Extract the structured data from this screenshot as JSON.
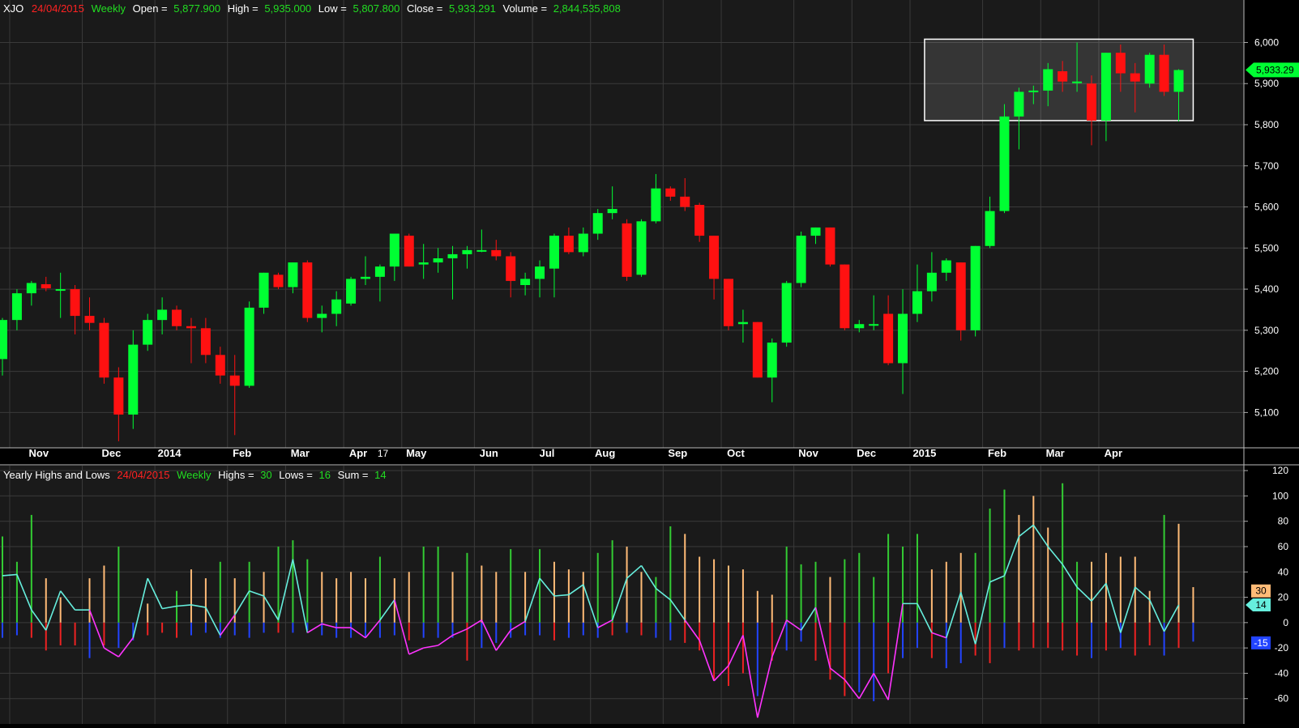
{
  "colors": {
    "background": "#000000",
    "panel": "#1a1a1a",
    "grid": "#3a3a3a",
    "axis_text": "#ffffff",
    "up": "#00ff33",
    "down": "#ff1111",
    "green_text": "#22dd22",
    "red_text": "#ff2222",
    "highs_bar": "#33cc33",
    "lows_bar": "#ee2222",
    "orange_bar": "#ffbb77",
    "blue_bar": "#2244ff",
    "sum_cyan": "#66eedd",
    "sum_magenta": "#ff33ff",
    "highlight_box": "#ffffff"
  },
  "price_header": {
    "symbol": "XJO",
    "date": "24/04/2015",
    "period": "Weekly",
    "open_label": "Open =",
    "open": "5,877.900",
    "high_label": "High =",
    "high": "5,935.000",
    "low_label": "Low =",
    "low": "5,807.800",
    "close_label": "Close =",
    "close": "5,933.291",
    "volume_label": "Volume =",
    "volume": "2,844,535,808"
  },
  "indicator_header": {
    "name": "Yearly Highs and Lows",
    "date": "24/04/2015",
    "period": "Weekly",
    "highs_label": "Highs =",
    "highs": "30",
    "lows_label": "Lows =",
    "lows": "16",
    "sum_label": "Sum =",
    "sum": "14"
  },
  "chart_data": [
    {
      "type": "candlestick",
      "title": "XJO Weekly",
      "ylim": [
        5020,
        6060
      ],
      "y_ticks": [
        "5,100",
        "5,200",
        "5,300",
        "5,400",
        "5,500",
        "5,600",
        "5,700",
        "5,800",
        "5,900",
        "6,000"
      ],
      "y_tick_values": [
        5100,
        5200,
        5300,
        5400,
        5500,
        5600,
        5700,
        5800,
        5900,
        6000
      ],
      "last_price_label": "5,933.29",
      "last_price_value": 5933.29,
      "x_month_labels": [
        "Nov",
        "Dec",
        "2014",
        "Feb",
        "Mar",
        "Apr",
        "17",
        "May",
        "Jun",
        "Jul",
        "Aug",
        "Sep",
        "Oct",
        "Nov",
        "Dec",
        "2015",
        "Feb",
        "Mar",
        "Apr"
      ],
      "x_month_label_week": [
        2.5,
        7.5,
        11.5,
        16.5,
        20.5,
        24.5,
        26.2,
        28.5,
        33.5,
        37.5,
        41.5,
        46.5,
        50.5,
        55.5,
        59.5,
        63.5,
        68.5,
        72.5,
        76.5
      ],
      "x_month_gridline_week": [
        0.5,
        5.5,
        10.5,
        15.5,
        19.5,
        23.5,
        27.5,
        32.5,
        36.5,
        40.5,
        45.5,
        49.5,
        54.5,
        58.5,
        62.5,
        67.5,
        71.5,
        75.5
      ],
      "highlight_box": {
        "from_week": 63.5,
        "to_week": 82,
        "low": 5810,
        "high": 6008
      },
      "candles": [
        {
          "o": 5230,
          "h": 5330,
          "l": 5190,
          "c": 5325
        },
        {
          "o": 5325,
          "h": 5400,
          "l": 5300,
          "c": 5390
        },
        {
          "o": 5390,
          "h": 5420,
          "l": 5360,
          "c": 5415
        },
        {
          "o": 5412,
          "h": 5430,
          "l": 5395,
          "c": 5402
        },
        {
          "o": 5400,
          "h": 5440,
          "l": 5330,
          "c": 5400
        },
        {
          "o": 5400,
          "h": 5410,
          "l": 5290,
          "c": 5335
        },
        {
          "o": 5335,
          "h": 5380,
          "l": 5300,
          "c": 5318
        },
        {
          "o": 5318,
          "h": 5330,
          "l": 5170,
          "c": 5185
        },
        {
          "o": 5185,
          "h": 5210,
          "l": 5030,
          "c": 5095
        },
        {
          "o": 5095,
          "h": 5300,
          "l": 5060,
          "c": 5265
        },
        {
          "o": 5265,
          "h": 5340,
          "l": 5250,
          "c": 5325
        },
        {
          "o": 5325,
          "h": 5380,
          "l": 5290,
          "c": 5350
        },
        {
          "o": 5350,
          "h": 5360,
          "l": 5300,
          "c": 5310
        },
        {
          "o": 5310,
          "h": 5330,
          "l": 5220,
          "c": 5305
        },
        {
          "o": 5305,
          "h": 5330,
          "l": 5220,
          "c": 5240
        },
        {
          "o": 5240,
          "h": 5260,
          "l": 5170,
          "c": 5190
        },
        {
          "o": 5190,
          "h": 5240,
          "l": 5045,
          "c": 5165
        },
        {
          "o": 5165,
          "h": 5370,
          "l": 5160,
          "c": 5355
        },
        {
          "o": 5355,
          "h": 5440,
          "l": 5340,
          "c": 5440
        },
        {
          "o": 5435,
          "h": 5440,
          "l": 5400,
          "c": 5405
        },
        {
          "o": 5405,
          "h": 5465,
          "l": 5390,
          "c": 5465
        },
        {
          "o": 5465,
          "h": 5470,
          "l": 5320,
          "c": 5330
        },
        {
          "o": 5330,
          "h": 5360,
          "l": 5295,
          "c": 5340
        },
        {
          "o": 5340,
          "h": 5395,
          "l": 5310,
          "c": 5375
        },
        {
          "o": 5365,
          "h": 5430,
          "l": 5360,
          "c": 5425
        },
        {
          "o": 5425,
          "h": 5480,
          "l": 5410,
          "c": 5430
        },
        {
          "o": 5430,
          "h": 5460,
          "l": 5370,
          "c": 5455
        },
        {
          "o": 5455,
          "h": 5535,
          "l": 5420,
          "c": 5535
        },
        {
          "o": 5530,
          "h": 5535,
          "l": 5455,
          "c": 5455
        },
        {
          "o": 5460,
          "h": 5510,
          "l": 5425,
          "c": 5465
        },
        {
          "o": 5465,
          "h": 5500,
          "l": 5440,
          "c": 5475
        },
        {
          "o": 5475,
          "h": 5505,
          "l": 5375,
          "c": 5485
        },
        {
          "o": 5485,
          "h": 5505,
          "l": 5450,
          "c": 5495
        },
        {
          "o": 5495,
          "h": 5545,
          "l": 5490,
          "c": 5495
        },
        {
          "o": 5495,
          "h": 5520,
          "l": 5470,
          "c": 5480
        },
        {
          "o": 5480,
          "h": 5490,
          "l": 5380,
          "c": 5420
        },
        {
          "o": 5410,
          "h": 5440,
          "l": 5385,
          "c": 5425
        },
        {
          "o": 5425,
          "h": 5470,
          "l": 5380,
          "c": 5455
        },
        {
          "o": 5450,
          "h": 5535,
          "l": 5380,
          "c": 5530
        },
        {
          "o": 5530,
          "h": 5550,
          "l": 5485,
          "c": 5490
        },
        {
          "o": 5490,
          "h": 5550,
          "l": 5480,
          "c": 5535
        },
        {
          "o": 5535,
          "h": 5595,
          "l": 5520,
          "c": 5585
        },
        {
          "o": 5585,
          "h": 5650,
          "l": 5570,
          "c": 5595
        },
        {
          "o": 5560,
          "h": 5570,
          "l": 5420,
          "c": 5430
        },
        {
          "o": 5435,
          "h": 5570,
          "l": 5430,
          "c": 5565
        },
        {
          "o": 5565,
          "h": 5680,
          "l": 5560,
          "c": 5645
        },
        {
          "o": 5645,
          "h": 5650,
          "l": 5615,
          "c": 5625
        },
        {
          "o": 5625,
          "h": 5670,
          "l": 5590,
          "c": 5600
        },
        {
          "o": 5605,
          "h": 5610,
          "l": 5515,
          "c": 5530
        },
        {
          "o": 5530,
          "h": 5530,
          "l": 5375,
          "c": 5425
        },
        {
          "o": 5425,
          "h": 5425,
          "l": 5300,
          "c": 5310
        },
        {
          "o": 5315,
          "h": 5350,
          "l": 5270,
          "c": 5320
        },
        {
          "o": 5320,
          "h": 5320,
          "l": 5185,
          "c": 5185
        },
        {
          "o": 5185,
          "h": 5280,
          "l": 5125,
          "c": 5270
        },
        {
          "o": 5270,
          "h": 5420,
          "l": 5260,
          "c": 5415
        },
        {
          "o": 5415,
          "h": 5540,
          "l": 5405,
          "c": 5530
        },
        {
          "o": 5530,
          "h": 5550,
          "l": 5510,
          "c": 5550
        },
        {
          "o": 5550,
          "h": 5550,
          "l": 5455,
          "c": 5460
        },
        {
          "o": 5460,
          "h": 5460,
          "l": 5300,
          "c": 5305
        },
        {
          "o": 5305,
          "h": 5325,
          "l": 5295,
          "c": 5315
        },
        {
          "o": 5315,
          "h": 5385,
          "l": 5300,
          "c": 5315
        },
        {
          "o": 5340,
          "h": 5385,
          "l": 5215,
          "c": 5220
        },
        {
          "o": 5220,
          "h": 5400,
          "l": 5145,
          "c": 5340
        },
        {
          "o": 5340,
          "h": 5460,
          "l": 5320,
          "c": 5395
        },
        {
          "o": 5395,
          "h": 5490,
          "l": 5370,
          "c": 5440
        },
        {
          "o": 5440,
          "h": 5475,
          "l": 5420,
          "c": 5470
        },
        {
          "o": 5465,
          "h": 5465,
          "l": 5275,
          "c": 5300
        },
        {
          "o": 5300,
          "h": 5505,
          "l": 5285,
          "c": 5505
        },
        {
          "o": 5505,
          "h": 5625,
          "l": 5500,
          "c": 5590
        },
        {
          "o": 5590,
          "h": 5850,
          "l": 5585,
          "c": 5820
        },
        {
          "o": 5820,
          "h": 5890,
          "l": 5740,
          "c": 5880
        },
        {
          "o": 5880,
          "h": 5895,
          "l": 5850,
          "c": 5883
        },
        {
          "o": 5883,
          "h": 5950,
          "l": 5845,
          "c": 5935
        },
        {
          "o": 5930,
          "h": 5955,
          "l": 5880,
          "c": 5905
        },
        {
          "o": 5905,
          "h": 6000,
          "l": 5880,
          "c": 5905
        },
        {
          "o": 5900,
          "h": 5920,
          "l": 5750,
          "c": 5810
        },
        {
          "o": 5810,
          "h": 5975,
          "l": 5760,
          "c": 5975
        },
        {
          "o": 5975,
          "h": 5995,
          "l": 5880,
          "c": 5925
        },
        {
          "o": 5925,
          "h": 5950,
          "l": 5830,
          "c": 5905
        },
        {
          "o": 5900,
          "h": 5975,
          "l": 5890,
          "c": 5970
        },
        {
          "o": 5970,
          "h": 5995,
          "l": 5870,
          "c": 5880
        },
        {
          "o": 5880,
          "h": 5935,
          "l": 5808,
          "c": 5933
        }
      ]
    },
    {
      "type": "bar_line",
      "title": "Yearly Highs and Lows",
      "ylim": [
        -80,
        122
      ],
      "y_ticks": [
        "120",
        "100",
        "80",
        "60",
        "40",
        "20",
        "0",
        "-20",
        "-40",
        "-60"
      ],
      "y_tick_values": [
        120,
        100,
        80,
        60,
        40,
        20,
        0,
        -20,
        -40,
        -60
      ],
      "tags": [
        {
          "label": "30",
          "value": 25,
          "color": "#ffbb77",
          "text_color": "#000000"
        },
        {
          "label": "14",
          "value": 14,
          "color": "#66eedd",
          "text_color": "#000000",
          "pointer": true
        },
        {
          "label": "-15",
          "value": -16,
          "color": "#2244ff",
          "text_color": "#ffffff"
        }
      ],
      "highs": [
        68,
        48,
        85,
        35,
        20,
        0,
        35,
        45,
        60,
        0,
        15,
        0,
        25,
        42,
        35,
        48,
        35,
        48,
        40,
        60,
        65,
        50,
        40,
        35,
        40,
        35,
        52,
        35,
        40,
        60,
        60,
        40,
        55,
        45,
        40,
        58,
        40,
        58,
        48,
        42,
        40,
        55,
        65,
        60,
        40,
        36,
        76,
        70,
        52,
        50,
        45,
        42,
        25,
        22,
        60,
        46,
        48,
        36,
        50,
        55,
        36,
        70,
        60,
        70,
        42,
        48,
        55,
        55,
        90,
        105,
        85,
        100,
        75,
        110,
        48,
        48,
        55,
        52,
        52,
        25,
        85,
        78,
        28
      ],
      "highs_color": [
        "g",
        "g",
        "g",
        "o",
        "o",
        "o",
        "o",
        "o",
        "g",
        "o",
        "o",
        "o",
        "g",
        "o",
        "o",
        "g",
        "o",
        "g",
        "o",
        "g",
        "g",
        "g",
        "o",
        "o",
        "o",
        "o",
        "g",
        "o",
        "o",
        "g",
        "g",
        "o",
        "g",
        "o",
        "o",
        "g",
        "o",
        "g",
        "o",
        "o",
        "o",
        "g",
        "g",
        "o",
        "o",
        "g",
        "g",
        "o",
        "o",
        "o",
        "o",
        "o",
        "o",
        "o",
        "g",
        "g",
        "g",
        "o",
        "g",
        "g",
        "g",
        "g",
        "g",
        "g",
        "o",
        "o",
        "o",
        "g",
        "g",
        "g",
        "o",
        "o",
        "o",
        "g",
        "g",
        "o",
        "o",
        "o",
        "o",
        "o",
        "g",
        "o",
        "o"
      ],
      "lows": [
        -12,
        -10,
        -12,
        -22,
        -18,
        -18,
        -28,
        -18,
        -20,
        -14,
        -10,
        -8,
        -12,
        -10,
        -8,
        -12,
        -10,
        -12,
        -8,
        -8,
        -8,
        -6,
        -10,
        -12,
        -12,
        -12,
        -12,
        -10,
        -14,
        -12,
        -12,
        -12,
        -30,
        -20,
        -16,
        -12,
        -10,
        -10,
        -14,
        -12,
        -10,
        -12,
        -10,
        -8,
        -10,
        -12,
        -14,
        -16,
        -22,
        -45,
        -50,
        -40,
        -58,
        -30,
        -22,
        -15,
        -30,
        -45,
        -58,
        -55,
        -62,
        -40,
        -28,
        -20,
        -28,
        -36,
        -32,
        -26,
        -32,
        -20,
        -22,
        -20,
        -20,
        -22,
        -26,
        -28,
        -22,
        -20,
        -26,
        -18,
        -26,
        -20,
        -15
      ],
      "lows_color": [
        "b",
        "b",
        "r",
        "r",
        "r",
        "r",
        "b",
        "r",
        "b",
        "b",
        "r",
        "r",
        "r",
        "b",
        "b",
        "b",
        "b",
        "b",
        "b",
        "r",
        "b",
        "b",
        "b",
        "b",
        "b",
        "b",
        "b",
        "b",
        "r",
        "b",
        "b",
        "b",
        "r",
        "b",
        "b",
        "b",
        "b",
        "b",
        "r",
        "b",
        "b",
        "b",
        "r",
        "b",
        "r",
        "b",
        "b",
        "r",
        "r",
        "r",
        "r",
        "r",
        "b",
        "r",
        "b",
        "b",
        "r",
        "r",
        "r",
        "b",
        "b",
        "r",
        "b",
        "b",
        "r",
        "b",
        "b",
        "r",
        "r",
        "b",
        "r",
        "r",
        "r",
        "r",
        "r",
        "b",
        "r",
        "b",
        "r",
        "r",
        "b",
        "r",
        "b"
      ],
      "sum": [
        37,
        38,
        10,
        -6,
        25,
        10,
        10,
        -20,
        -27,
        -12,
        35,
        11,
        13,
        14,
        12,
        -10,
        6,
        25,
        21,
        2,
        50,
        -8,
        -1,
        -4,
        -4,
        -12,
        2,
        18,
        -25,
        -20,
        -18,
        -10,
        -5,
        2,
        -22,
        -6,
        1,
        35,
        21,
        22,
        30,
        -4,
        2,
        35,
        45,
        27,
        18,
        2,
        -14,
        -46,
        -34,
        -10,
        -75,
        -27,
        2,
        -6,
        12,
        -36,
        -45,
        -60,
        -40,
        -61,
        15,
        15,
        -8,
        -12,
        24,
        -17,
        32,
        37,
        68,
        77,
        60,
        46,
        28,
        17,
        31,
        -8,
        28,
        18,
        -7,
        14
      ]
    }
  ]
}
